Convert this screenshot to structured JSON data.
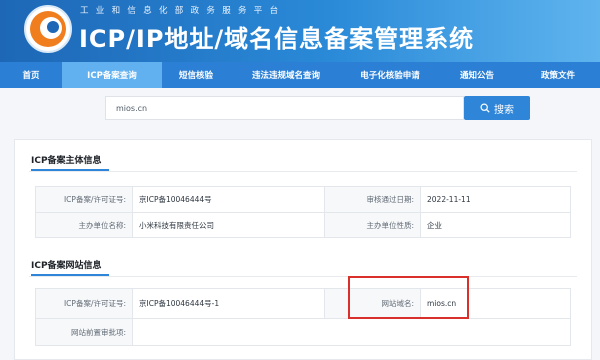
{
  "header": {
    "subtitle": "工业和信息化部政务服务平台",
    "title": "ICP/IP地址/域名信息备案管理系统"
  },
  "nav": {
    "items": [
      {
        "label": "首页"
      },
      {
        "label": "ICP备案查询"
      },
      {
        "label": "短信核验"
      },
      {
        "label": "违法违规域名查询"
      },
      {
        "label": "电子化核验申请"
      },
      {
        "label": "通知公告"
      },
      {
        "label": "政策文件"
      }
    ]
  },
  "search": {
    "value": "mios.cn",
    "button_label": "搜索"
  },
  "subject_info": {
    "section_title": "ICP备案主体信息",
    "license_label": "ICP备案/许可证号:",
    "license_value": "京ICP备10046444号",
    "approval_date_label": "审核通过日期:",
    "approval_date_value": "2022-11-11",
    "sponsor_name_label": "主办单位名称:",
    "sponsor_name_value": "小米科技有限责任公司",
    "sponsor_type_label": "主办单位性质:",
    "sponsor_type_value": "企业"
  },
  "website_info": {
    "section_title": "ICP备案网站信息",
    "license_label": "ICP备案/许可证号:",
    "license_value": "京ICP备10046444号-1",
    "domain_label": "网站域名:",
    "domain_value": "mios.cn",
    "pre_approval_label": "网站前置审批项:"
  },
  "colors": {
    "primary": "#2b7fd4",
    "active_tab": "#61b0ef",
    "highlight": "#d9302c"
  }
}
